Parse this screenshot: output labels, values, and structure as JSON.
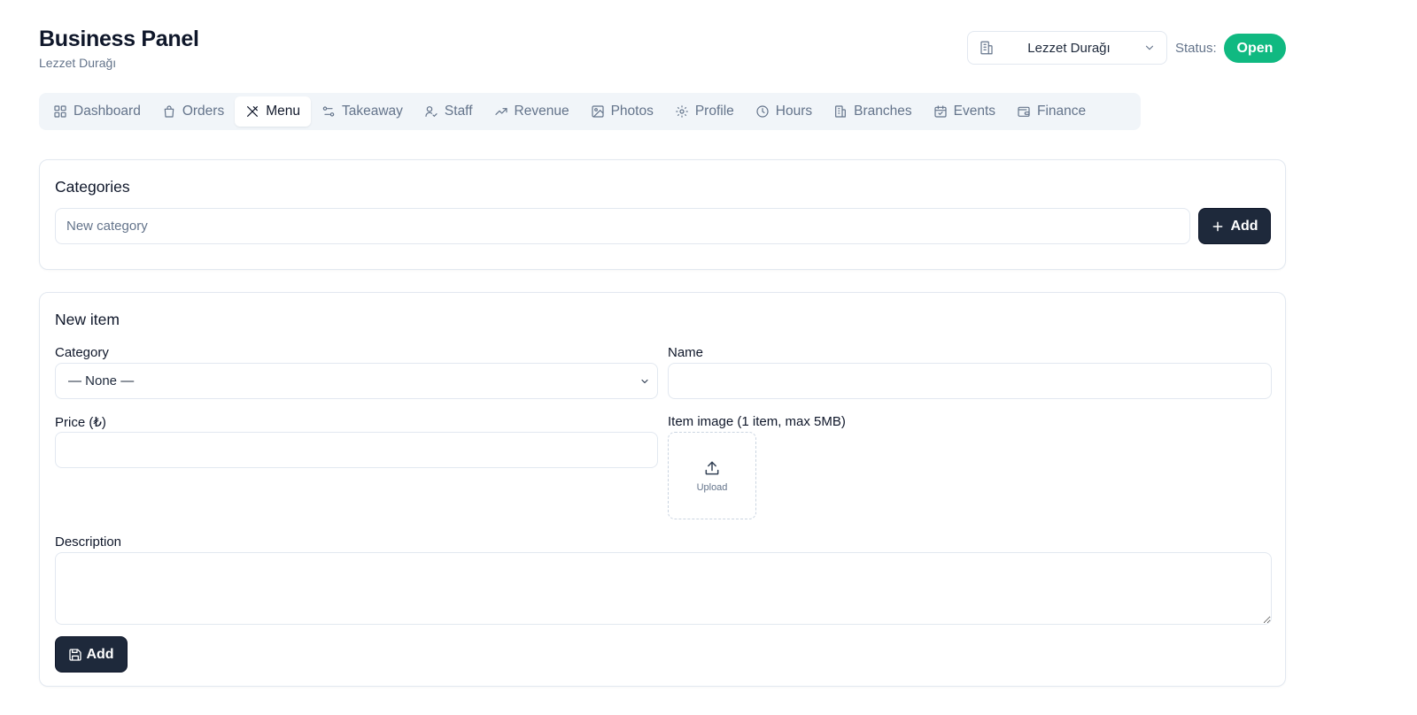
{
  "header": {
    "title": "Business Panel",
    "subtitle": "Lezzet Durağı"
  },
  "branch_select": {
    "value": "Lezzet Durağı"
  },
  "status": {
    "label": "Status:",
    "value": "Open",
    "color": "#10b981"
  },
  "tabs": [
    {
      "label": "Dashboard",
      "icon": "grid-icon",
      "active": false
    },
    {
      "label": "Orders",
      "icon": "bag-icon",
      "active": false
    },
    {
      "label": "Menu",
      "icon": "utensils-icon",
      "active": true
    },
    {
      "label": "Takeaway",
      "icon": "route-icon",
      "active": false
    },
    {
      "label": "Staff",
      "icon": "user-check-icon",
      "active": false
    },
    {
      "label": "Revenue",
      "icon": "trending-up-icon",
      "active": false
    },
    {
      "label": "Photos",
      "icon": "image-icon",
      "active": false
    },
    {
      "label": "Profile",
      "icon": "gear-icon",
      "active": false
    },
    {
      "label": "Hours",
      "icon": "clock-icon",
      "active": false
    },
    {
      "label": "Branches",
      "icon": "buildings-icon",
      "active": false
    },
    {
      "label": "Events",
      "icon": "calendar-check-icon",
      "active": false
    },
    {
      "label": "Finance",
      "icon": "wallet-icon",
      "active": false
    }
  ],
  "categories": {
    "title": "Categories",
    "input_placeholder": "New category",
    "add_label": "Add"
  },
  "new_item": {
    "title": "New item",
    "category_label": "Category",
    "category_value": "— None —",
    "name_label": "Name",
    "price_label": "Price (₺)",
    "image_label": "Item image (1 item, max 5MB)",
    "upload_label": "Upload",
    "description_label": "Description",
    "add_label": "Add"
  },
  "colors": {
    "accent_dark": "#1e293b",
    "status_green": "#10b981"
  }
}
